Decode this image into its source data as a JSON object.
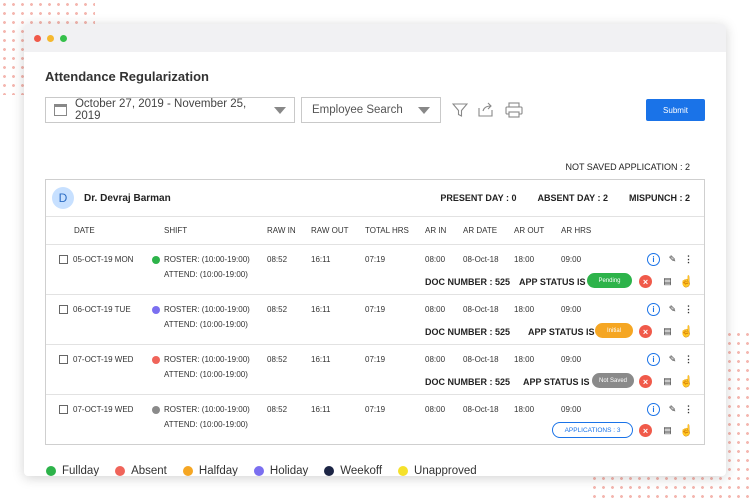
{
  "page": {
    "title": "Attendance Regularization"
  },
  "toolbar": {
    "date_range": "October 27, 2019 - November 25, 2019",
    "employee_search": "Employee Search",
    "submit_label": "Submit"
  },
  "status_line": "NOT SAVED APPLICATION : 2",
  "employee": {
    "initial": "D",
    "name": "Dr. Devraj Barman",
    "present": "PRESENT DAY : 0",
    "absent": "ABSENT DAY : 2",
    "mispunch": "MISPUNCH : 2"
  },
  "columns": [
    "DATE",
    "SHIFT",
    "RAW IN",
    "RAW OUT",
    "TOTAL HRS",
    "AR IN",
    "AR DATE",
    "AR OUT",
    "AR HRS"
  ],
  "rows": [
    {
      "date": "05-OCT-19 MON",
      "roster": "ROSTER: (10:00-19:00)",
      "attend": "ATTEND: (10:00-19:00)",
      "raw_in": "08:52",
      "raw_out": "16:11",
      "total": "07:19",
      "ar_in": "08:00",
      "ar_date": "08-Oct-18",
      "ar_out": "18:00",
      "ar_hrs": "09:00",
      "doc": "DOC NUMBER : 525",
      "app_status": "APP STATUS IS",
      "badge": "Pending",
      "badge_color": "#2db34a",
      "dot_color": "#2db34a"
    },
    {
      "date": "06-OCT-19 TUE",
      "roster": "ROSTER: (10:00-19:00)",
      "attend": "ATTEND: (10:00-19:00)",
      "raw_in": "08:52",
      "raw_out": "16:11",
      "total": "07:19",
      "ar_in": "08:00",
      "ar_date": "08-Oct-18",
      "ar_out": "18:00",
      "ar_hrs": "09:00",
      "doc": "DOC NUMBER : 525",
      "app_status": "APP STATUS IS",
      "badge": "Initial",
      "badge_color": "#f5a623",
      "dot_color": "#7b6ff0"
    },
    {
      "date": "07-OCT-19 WED",
      "roster": "ROSTER: (10:00-19:00)",
      "attend": "ATTEND: (10:00-19:00)",
      "raw_in": "08:52",
      "raw_out": "16:11",
      "total": "07:19",
      "ar_in": "08:00",
      "ar_date": "08-Oct-18",
      "ar_out": "18:00",
      "ar_hrs": "09:00",
      "doc": "DOC NUMBER : 525",
      "app_status": "APP STATUS IS",
      "badge": "Not Saved",
      "badge_color": "#8a8a8a",
      "dot_color": "#f0645a"
    },
    {
      "date": "07-OCT-19 WED",
      "roster": "ROSTER: (10:00-19:00)",
      "attend": "ATTEND: (10:00-19:00)",
      "raw_in": "08:52",
      "raw_out": "16:11",
      "total": "07:19",
      "ar_in": "08:00",
      "ar_date": "08-Oct-18",
      "ar_out": "18:00",
      "ar_hrs": "09:00",
      "applications": "APPLICATIONS : 3",
      "dot_color": "#8a8a8a"
    }
  ],
  "legend": [
    {
      "label": "Fullday",
      "color": "#2db34a"
    },
    {
      "label": "Absent",
      "color": "#f0645a"
    },
    {
      "label": "Halfday",
      "color": "#f5a623"
    },
    {
      "label": "Holiday",
      "color": "#7b6ff0"
    },
    {
      "label": "Weekoff",
      "color": "#1c2545"
    },
    {
      "label": "Unapproved",
      "color": "#f5e12b"
    }
  ]
}
